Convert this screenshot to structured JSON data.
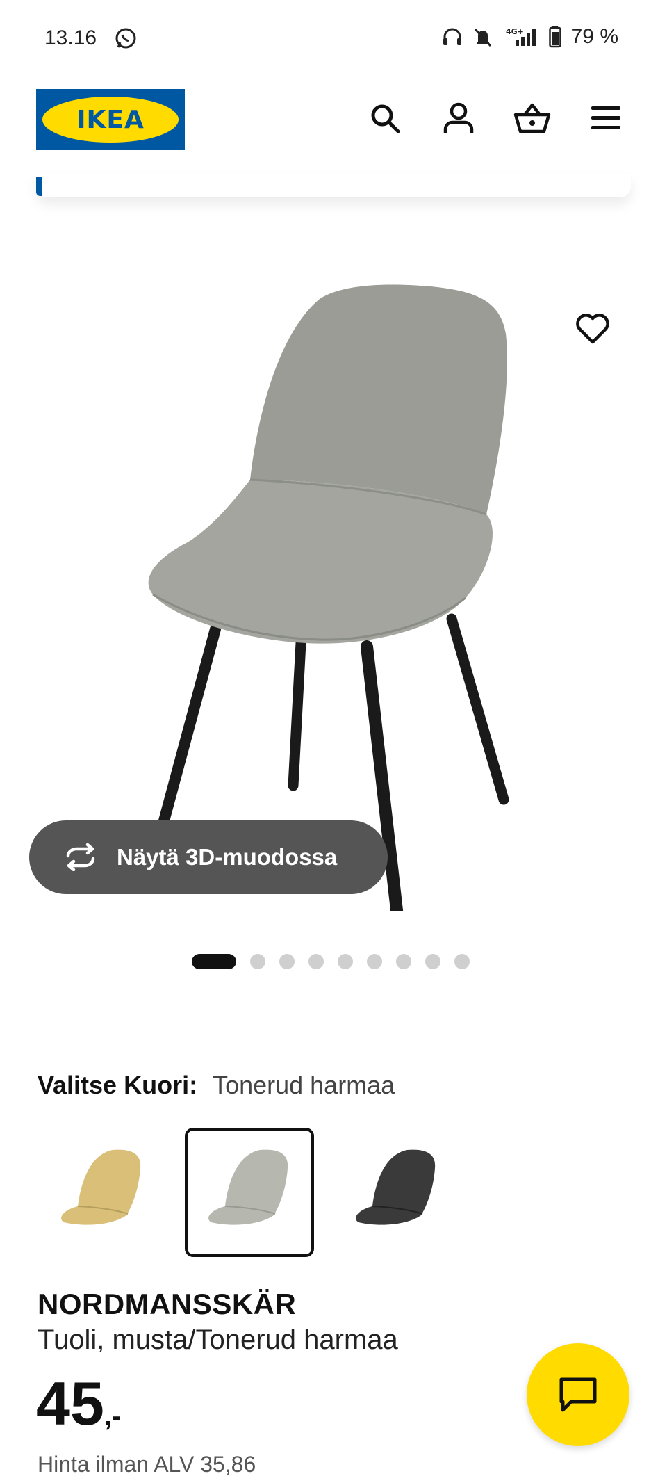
{
  "status_bar": {
    "time": "13.16",
    "battery": "79 %",
    "network": "4G+"
  },
  "header": {
    "logo_text": "IKEA",
    "icons": [
      "search-icon",
      "account-icon",
      "cart-icon",
      "menu-icon"
    ]
  },
  "gallery": {
    "view_3d_label": "Näytä 3D-muodossa",
    "image_count": 9,
    "active_index": 0
  },
  "variant": {
    "label": "Valitse Kuori:",
    "selected_value": "Tonerud harmaa",
    "swatches": [
      {
        "color": "#d9bf78",
        "selected": false
      },
      {
        "color": "#b6b7ae",
        "selected": true
      },
      {
        "color": "#3a3a3a",
        "selected": false
      }
    ]
  },
  "product": {
    "name": "NORDMANSSKÄR",
    "description": "Tuoli, musta/Tonerud harmaa",
    "price": "45",
    "price_suffix": ",-",
    "price_ex_vat": "Hinta ilman ALV 35,86"
  },
  "colors": {
    "brand_blue": "#0058a3",
    "brand_yellow": "#ffdb00"
  }
}
